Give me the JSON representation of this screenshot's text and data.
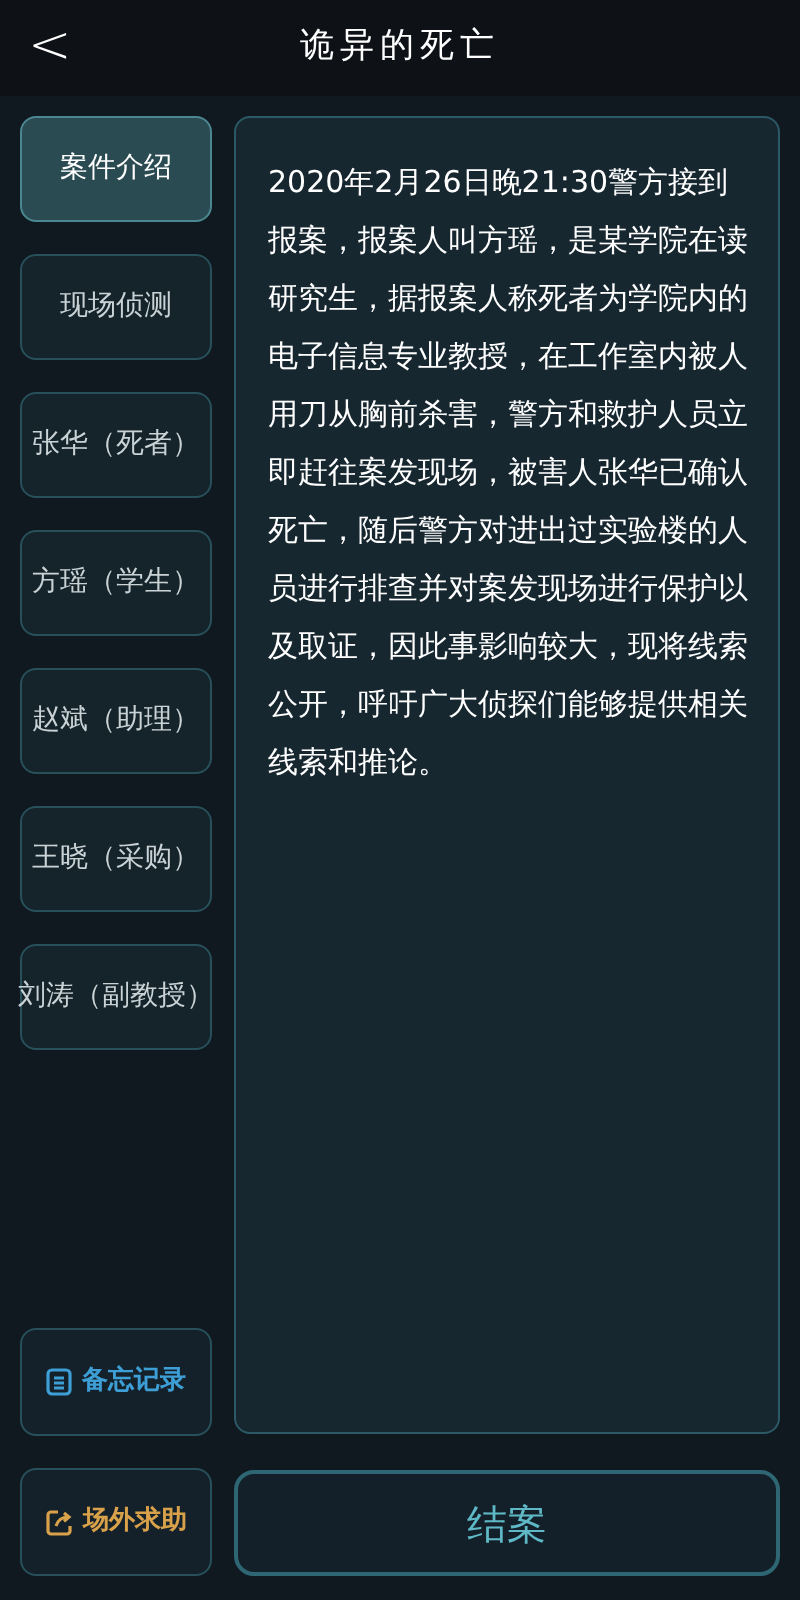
{
  "header": {
    "back": "<",
    "title": "诡异的死亡"
  },
  "sidebar": {
    "items": [
      {
        "label": "案件介绍",
        "selected": true
      },
      {
        "label": "现场侦测",
        "selected": false
      },
      {
        "label": "张华（死者）",
        "selected": false
      },
      {
        "label": "方瑶（学生）",
        "selected": false
      },
      {
        "label": "赵斌（助理）",
        "selected": false
      },
      {
        "label": "王晓（采购）",
        "selected": false
      },
      {
        "label": "刘涛（副教授）",
        "selected": false
      }
    ],
    "tools": [
      {
        "kind": "memo",
        "label": "备忘记录"
      },
      {
        "kind": "help",
        "label": "场外求助"
      }
    ]
  },
  "content": {
    "text": "2020年2月26日晚21:30警方接到报案，报案人叫方瑶，是某学院在读研究生，据报案人称死者为学院内的电子信息专业教授，在工作室内被人用刀从胸前杀害，警方和救护人员立即赶往案发现场，被害人张华已确认死亡，随后警方对进出过实验楼的人员进行排查并对案发现场进行保护以及取证，因此事影响较大，现将线索公开，呼吁广大侦探们能够提供相关线索和推论。"
  },
  "close_case_button": "结案"
}
